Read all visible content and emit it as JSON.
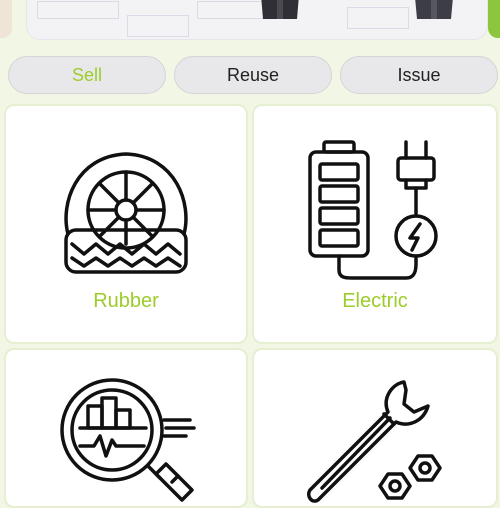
{
  "tabs": {
    "sell": "Sell",
    "reuse": "Reuse",
    "issue": "Issue"
  },
  "categories": [
    {
      "label": "Rubber",
      "icon": "tire-icon"
    },
    {
      "label": "Electric",
      "icon": "battery-plug-icon"
    },
    {
      "label": "",
      "icon": "magnifier-chart-icon"
    },
    {
      "label": "",
      "icon": "wrench-nuts-icon"
    }
  ],
  "colors": {
    "accent": "#9ccc2a",
    "background": "#f1f7e4",
    "tab_bg": "#e8e8ea"
  }
}
